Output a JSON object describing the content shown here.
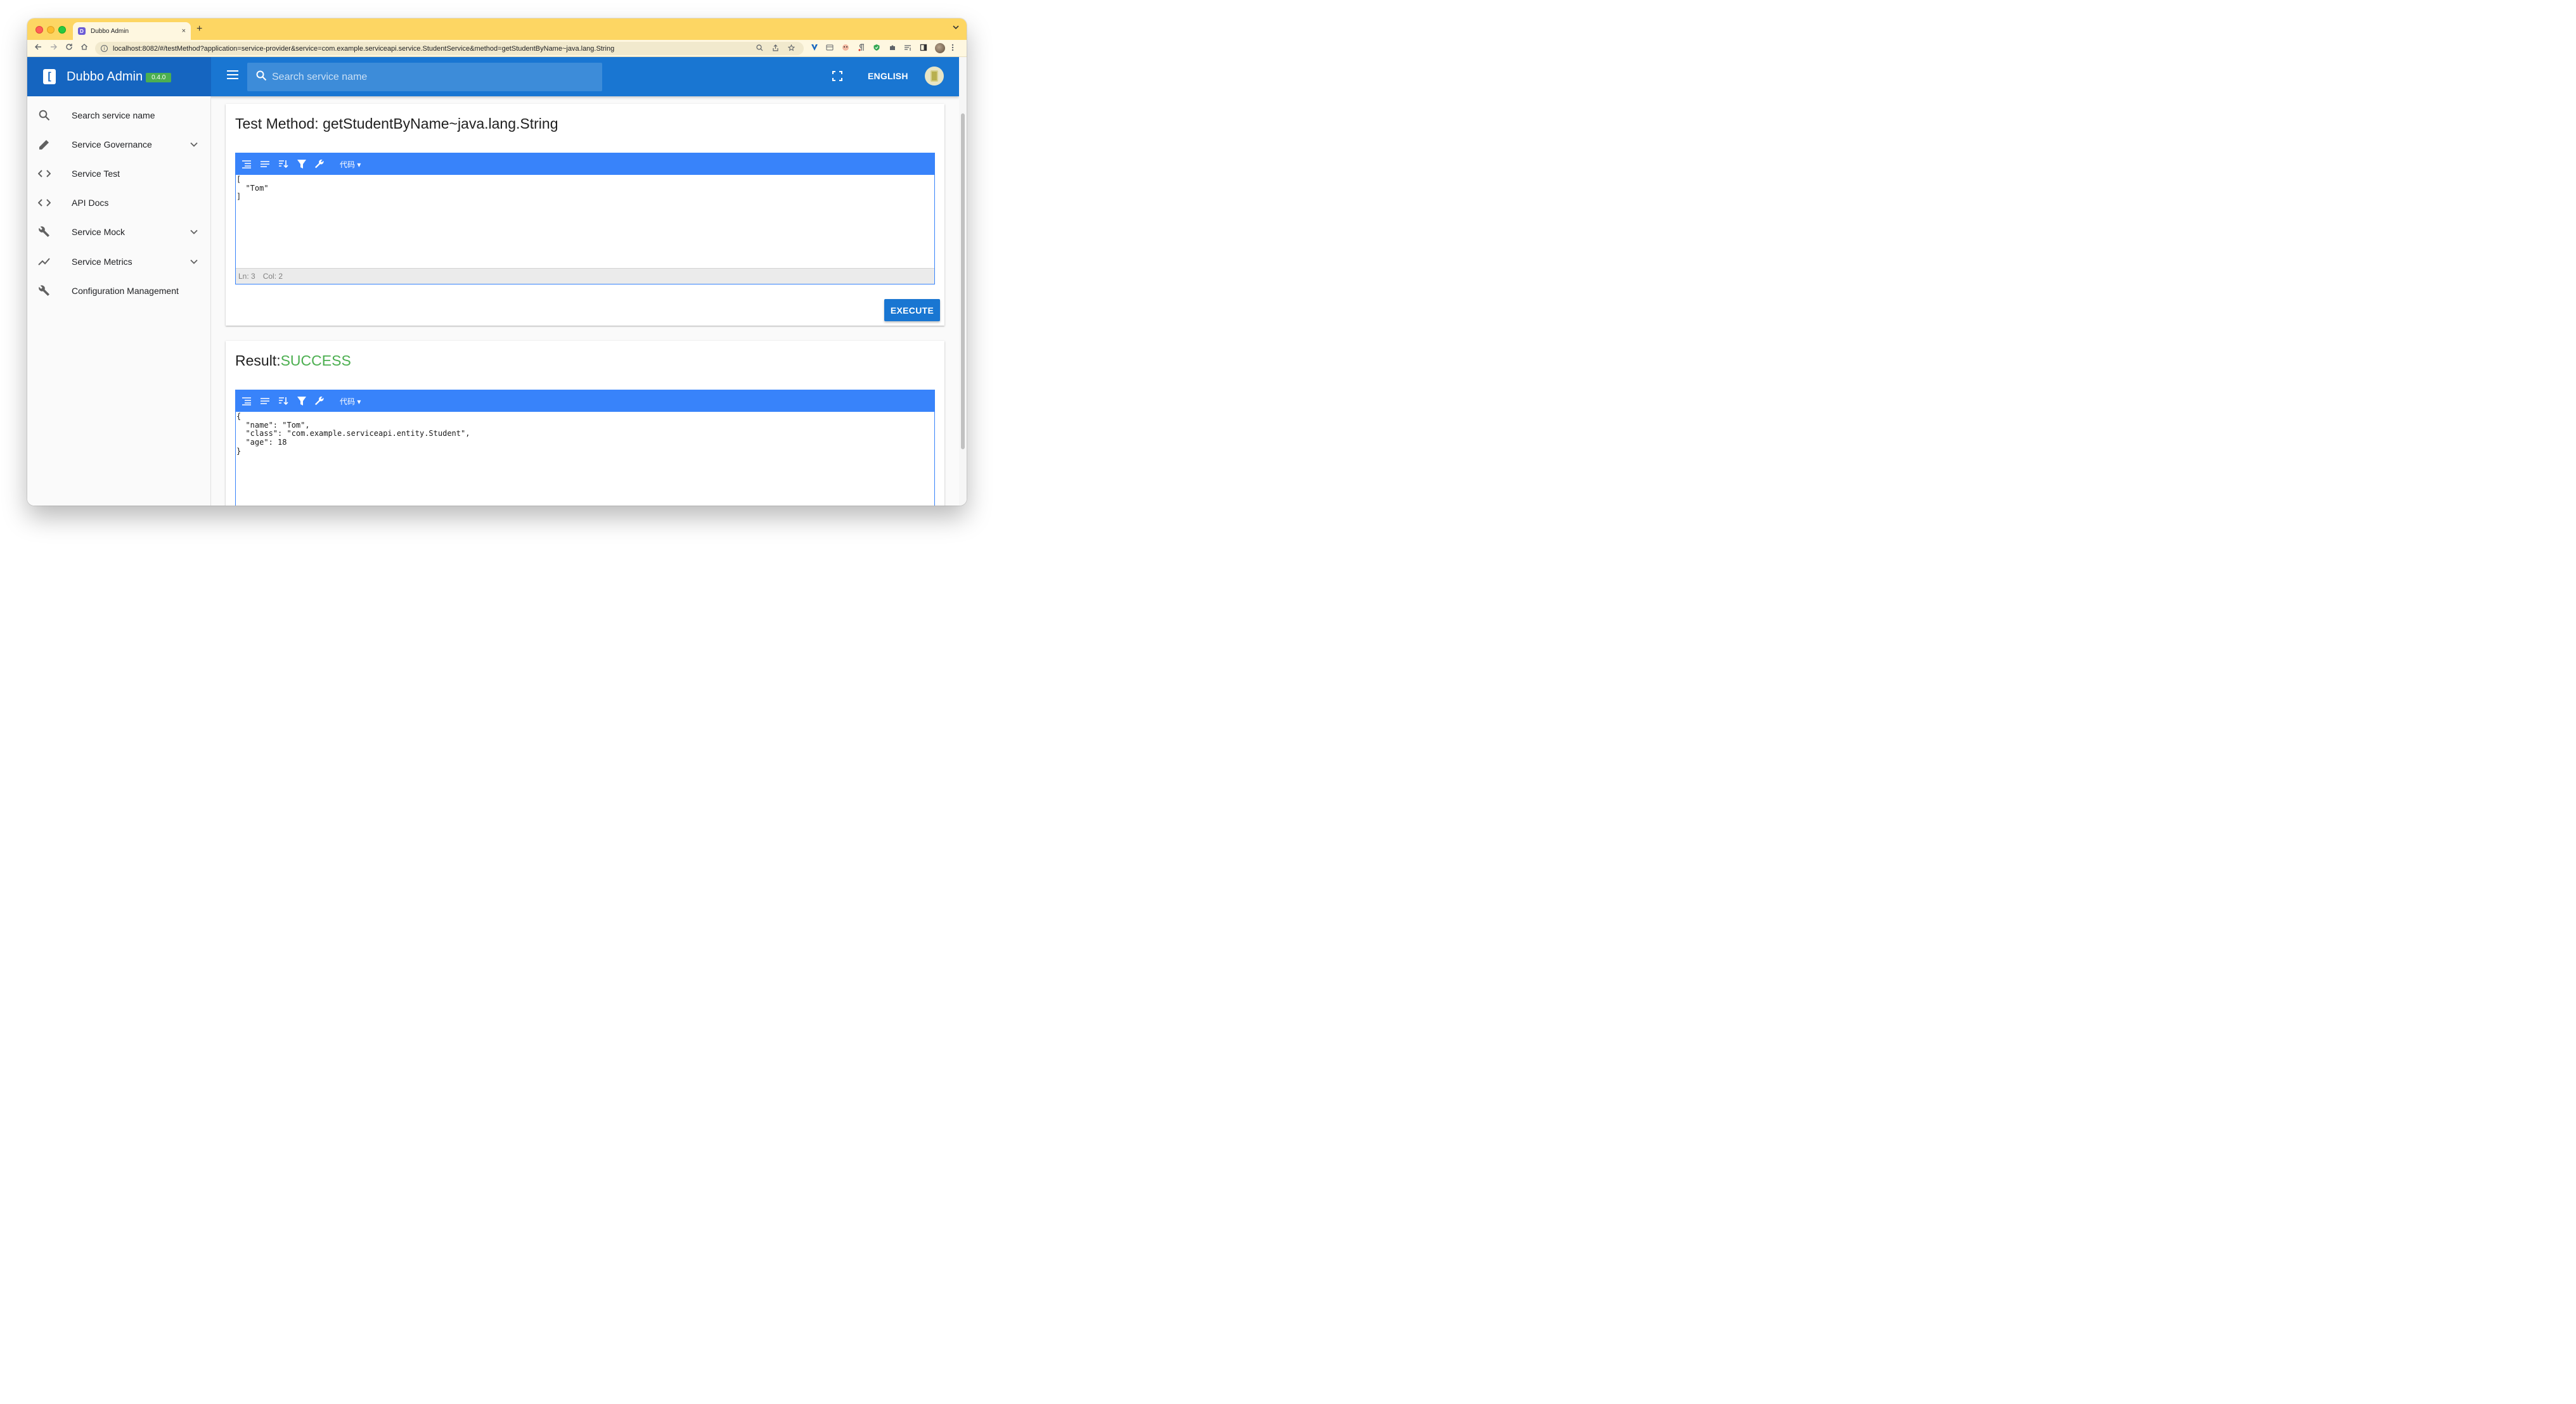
{
  "browser": {
    "tab_title": "Dubbo Admin",
    "tab_favicon": "D",
    "new_tab": "+",
    "close_tab": "×",
    "url": "localhost:8082/#/testMethod?application=service-provider&service=com.example.serviceapi.service.StudentService&method=getStudentByName~java.lang.String"
  },
  "app": {
    "brand_logo": "[",
    "brand_name": "Dubbo Admin",
    "version": "0.4.0",
    "search_placeholder": "Search service name",
    "language_button": "ENGLISH"
  },
  "sidebar": {
    "items": [
      {
        "label": "Search service name",
        "icon": "search-icon",
        "expandable": false
      },
      {
        "label": "Service Governance",
        "icon": "pencil-icon",
        "expandable": true
      },
      {
        "label": "Service Test",
        "icon": "code-icon",
        "expandable": false
      },
      {
        "label": "API Docs",
        "icon": "code-icon",
        "expandable": false
      },
      {
        "label": "Service Mock",
        "icon": "wrench-icon",
        "expandable": true
      },
      {
        "label": "Service Metrics",
        "icon": "trending-up-icon",
        "expandable": true
      },
      {
        "label": "Configuration Management",
        "icon": "wrench-icon",
        "expandable": false
      }
    ]
  },
  "test_card": {
    "title": "Test Method: getStudentByName~java.lang.String",
    "editor_mode": "代码",
    "code_lines": [
      "[",
      "  \"Tom\"",
      "]"
    ],
    "status_ln": "Ln: 3",
    "status_col": "Col: 2",
    "execute_label": "EXECUTE"
  },
  "result_card": {
    "title_prefix": "Result:",
    "status": "SUCCESS",
    "editor_mode": "代码",
    "code_lines": [
      "{",
      "  \"name\": \"Tom\",",
      "  \"class\": \"com.example.serviceapi.entity.Student\",",
      "  \"age\": 18",
      "}"
    ]
  },
  "colors": {
    "appbar": "#1976d2",
    "brand_bg": "#1565c0",
    "editor_accent": "#3883fa",
    "success": "#4caf50",
    "chrome_frame": "#fdd663"
  }
}
